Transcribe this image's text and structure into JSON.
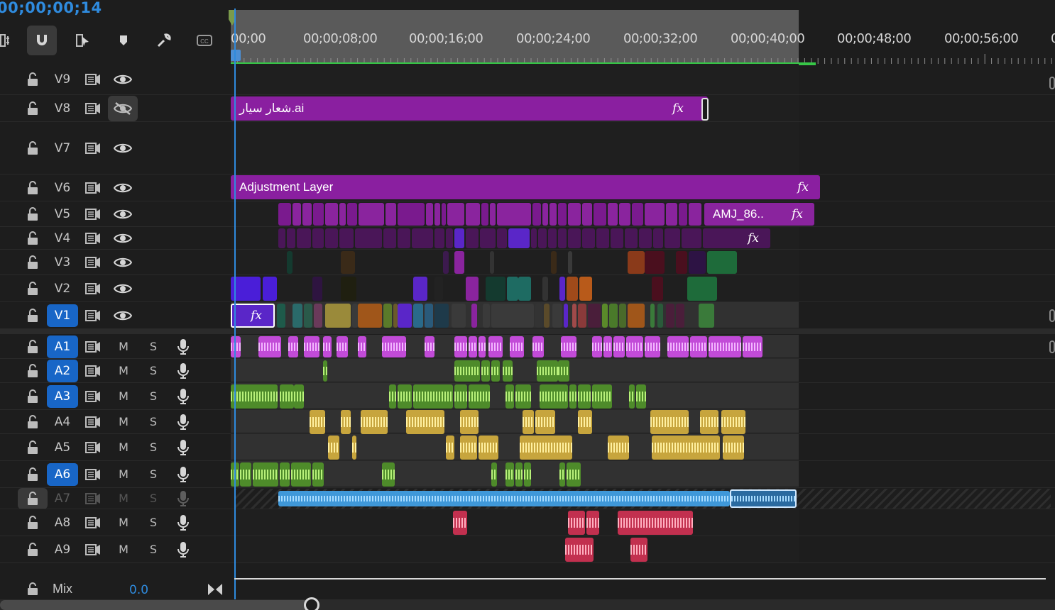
{
  "timecode": "00;00;00;14",
  "ruler": {
    "labels": [
      "00;00",
      "00;00;08;00",
      "00;00;16;00",
      "00;00;24;00",
      "00;00;32;00",
      "00;00;40;00",
      "00;00;48;00",
      "00;00;56;00",
      "0"
    ]
  },
  "toolbar": {
    "tools": [
      "insert-nest-icon",
      "magnet-snap-icon",
      "linked-selection-icon",
      "marker-icon",
      "wrench-settings-icon",
      "captions-icon"
    ]
  },
  "video_tracks": [
    {
      "name": "V9",
      "targeted": false,
      "hidden": false
    },
    {
      "name": "V8",
      "targeted": false,
      "hidden": true
    },
    {
      "name": "V7",
      "targeted": false,
      "hidden": false
    },
    {
      "name": "V6",
      "targeted": false,
      "hidden": false
    },
    {
      "name": "V5",
      "targeted": false,
      "hidden": false
    },
    {
      "name": "V4",
      "targeted": false,
      "hidden": false
    },
    {
      "name": "V3",
      "targeted": false,
      "hidden": false
    },
    {
      "name": "V2",
      "targeted": false,
      "hidden": false
    },
    {
      "name": "V1",
      "targeted": true,
      "hidden": false
    }
  ],
  "audio_tracks": [
    {
      "name": "A1",
      "targeted": true,
      "mute": "M",
      "solo": "S"
    },
    {
      "name": "A2",
      "targeted": true,
      "mute": "M",
      "solo": "S"
    },
    {
      "name": "A3",
      "targeted": true,
      "mute": "M",
      "solo": "S"
    },
    {
      "name": "A4",
      "targeted": false,
      "mute": "M",
      "solo": "S"
    },
    {
      "name": "A5",
      "targeted": false,
      "mute": "M",
      "solo": "S"
    },
    {
      "name": "A6",
      "targeted": true,
      "mute": "M",
      "solo": "S"
    },
    {
      "name": "A7",
      "targeted": false,
      "locked": true,
      "mute": "M",
      "solo": "S"
    },
    {
      "name": "A8",
      "targeted": false,
      "mute": "M",
      "solo": "S"
    },
    {
      "name": "A9",
      "targeted": false,
      "mute": "M",
      "solo": "S"
    }
  ],
  "clips": {
    "v8_title": "شعار سيار.ai",
    "v6_title": "Adjustment Layer",
    "v5_title": "AMJ_86..",
    "fx": "fx"
  },
  "mix": {
    "label": "Mix",
    "value": "0.0"
  },
  "colors": {
    "accent": "#2f8bde",
    "purple_clip": "#8a1fa0",
    "audio_pink": "#c24bd8",
    "audio_green": "#4e8b2a",
    "audio_yellow": "#c7a53d",
    "audio_blue": "#3f98d9",
    "audio_red": "#c2304f"
  }
}
